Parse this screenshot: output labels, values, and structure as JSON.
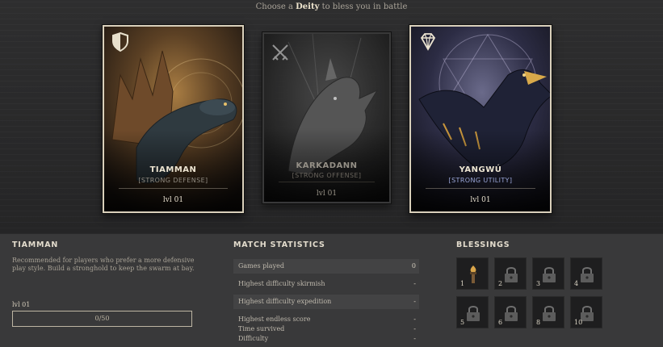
{
  "header": {
    "prefix": "Choose a ",
    "accent": "Deity",
    "suffix": " to bless you in battle"
  },
  "cards": [
    {
      "name": "TIAMMAN",
      "subtitle": "[STRONG DEFENSE]",
      "level": "lvl 01",
      "icon": "shield-icon",
      "selected": true
    },
    {
      "name": "KARKADANN",
      "subtitle": "[STRONG OFFENSE]",
      "level": "lvl 01",
      "icon": "crossed-swords-icon",
      "selected": false
    },
    {
      "name": "YANGWÚ",
      "subtitle": "[STRONG UTILITY]",
      "level": "lvl 01",
      "icon": "diamond-icon",
      "selected": false
    }
  ],
  "details": {
    "title": "TIAMMAN",
    "description": "Recommended for players who prefer a more defensive play style. Build a stronghold to keep the swarm at bay.",
    "level_label": "lvl 01",
    "xp_text": "0/50",
    "xp_fraction": 0
  },
  "stats": {
    "title": "MATCH STATISTICS",
    "rows": [
      {
        "label": "Games played",
        "value": "0"
      },
      {
        "label": "Highest difficulty skirmish",
        "value": "-"
      },
      {
        "label": "Highest difficulty expedition",
        "value": "-"
      },
      {
        "label": "Highest endless score",
        "value": "-"
      },
      {
        "label": "Time survived",
        "value": "-"
      },
      {
        "label": "Difficulty",
        "value": "-"
      }
    ]
  },
  "blessings": {
    "title": "BLESSINGS",
    "items": [
      {
        "number": "1",
        "unlocked": true
      },
      {
        "number": "2",
        "unlocked": false
      },
      {
        "number": "3",
        "unlocked": false
      },
      {
        "number": "4",
        "unlocked": false
      },
      {
        "number": "5",
        "unlocked": false
      },
      {
        "number": "6",
        "unlocked": false
      },
      {
        "number": "8",
        "unlocked": false
      },
      {
        "number": "10",
        "unlocked": false
      }
    ]
  },
  "colors": {
    "accent": "#f0e6cf",
    "card_border": "#d9d0bb",
    "subtitle_muted": "#8f8a80",
    "subtitle_blue": "#9aa6d8"
  }
}
